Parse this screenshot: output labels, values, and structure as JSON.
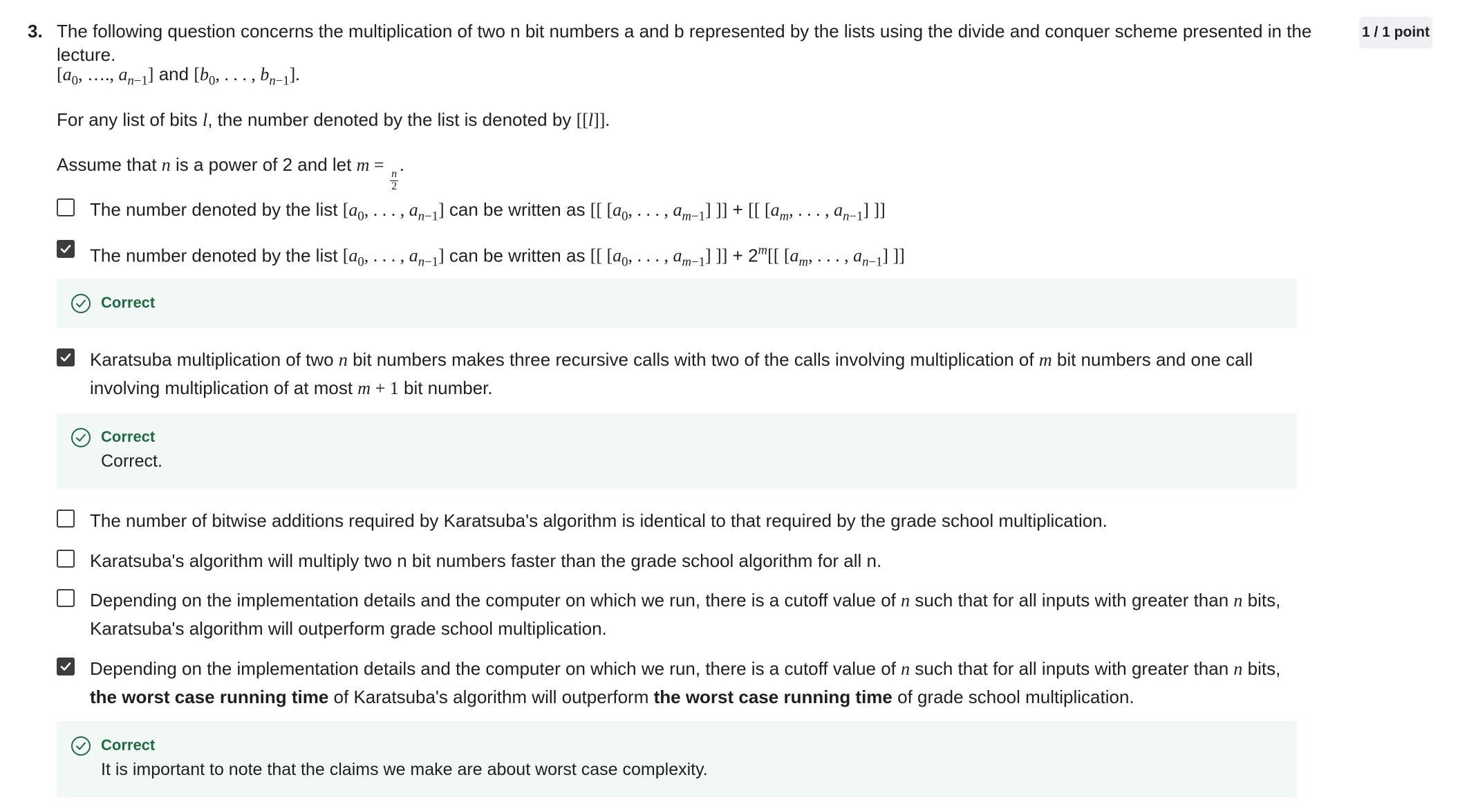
{
  "question": {
    "number": "3.",
    "text": "The following question concerns the multiplication of two n bit numbers a and b represented by the lists using the divide and conquer scheme presented in the lecture.",
    "points": "1 / 1 point",
    "lists_and": "and",
    "bits_prefix": "For any list of bits",
    "bits_middle": ", the number denoted by the list is denoted by",
    "assume_prefix": "Assume that",
    "assume_middle": "is a power of 2 and let"
  },
  "options": [
    {
      "prefix": "The number denoted by the list",
      "middle": "can be written as",
      "plus": "+",
      "checked": false
    },
    {
      "prefix": "The number denoted by the list",
      "middle": "can be written as",
      "plus": "+ 2",
      "checked": true,
      "feedback_title": "Correct"
    },
    {
      "part1": "Karatsuba multiplication of two",
      "part2": "bit numbers makes three recursive calls with two of the calls involving multiplication of",
      "part3": "bit numbers  and one call involving multiplication of at most",
      "part4": "bit number.",
      "checked": true,
      "feedback_title": "Correct",
      "feedback_text": "Correct."
    },
    {
      "text": "The number of bitwise additions required by Karatsuba's algorithm is identical to that required by the grade school multiplication.",
      "checked": false
    },
    {
      "text": "Karatsuba's algorithm will multiply two n bit numbers faster than the grade school algorithm for all n.",
      "checked": false
    },
    {
      "part1": "Depending on the implementation details and the computer on which we run, there is a cutoff value of",
      "part2": "such that for all inputs with greater than",
      "part3": "bits, Karatsuba's algorithm will outperform grade school multiplication.",
      "checked": false
    },
    {
      "part1": "Depending on the implementation details and the computer on which we run, there is a cutoff value of",
      "part2": "such that for all inputs with greater than",
      "part3": "bits,",
      "bold1": "the worst case running time",
      "part4": "of Karatsuba's algorithm will outperform",
      "bold2": "the worst case running time",
      "part5": "of  grade school multiplication.",
      "checked": true,
      "feedback_title": "Correct",
      "feedback_text": "It is important to note that the claims we make are about worst case complexity."
    }
  ],
  "colors": {
    "correct_green": "#1e6b44",
    "feedback_bg": "#f2f8f5",
    "checkbox": "#3d3d3d",
    "badge_bg": "#eef0f3"
  },
  "icons": {
    "checkbox_checked": "check-mark-icon",
    "feedback": "check-circle-icon"
  }
}
